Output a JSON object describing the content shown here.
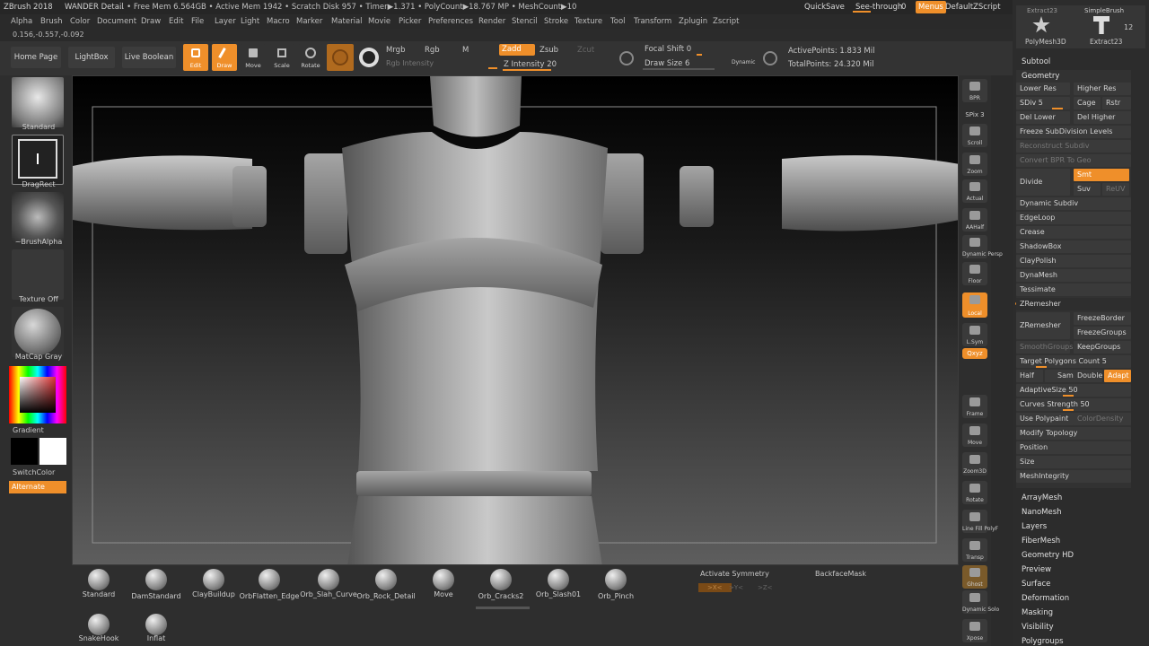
{
  "titlebar": {
    "app": "ZBrush 2018",
    "document": "WANDER Detail",
    "stats": ".. • Free Mem 6.564GB • Active Mem 1942 • Scratch Disk 957 • Timer▶1.371 • PolyCount▶18.767 MP • MeshCount▶10",
    "quicksave": "QuickSave",
    "see_through": "See-through",
    "see_through_value": "0",
    "menus": "Menus",
    "script": "DefaultZScript"
  },
  "menubar": [
    "Alpha",
    "Brush",
    "Color",
    "Document",
    "Draw",
    "Edit",
    "File",
    "Layer",
    "Light",
    "Macro",
    "Marker",
    "Material",
    "Movie",
    "Picker",
    "Preferences",
    "Render",
    "Stencil",
    "Stroke",
    "Texture",
    "Tool",
    "Transform",
    "Zplugin",
    "Zscript"
  ],
  "coords": "0.156,-0.557,-0.092",
  "shelf": {
    "home_page": "Home Page",
    "lightbox": "LightBox",
    "live_boolean": "Live Boolean",
    "edit": "Edit",
    "draw": "Draw",
    "move": "Move",
    "scale": "Scale",
    "rotate": "Rotate",
    "mrgb": "Mrgb",
    "rgb": "Rgb",
    "m": "M",
    "rgb_intensity": "Rgb Intensity",
    "zadd": "Zadd",
    "zsub": "Zsub",
    "zcut": "Zcut",
    "z_intensity": "Z Intensity 20",
    "focal_shift": "Focal Shift 0",
    "draw_size": "Draw Size 6",
    "dynamic": "Dynamic",
    "active_points": "ActivePoints: 1.833 Mil",
    "total_points": "TotalPoints: 24.320 Mil"
  },
  "left": {
    "brush": "Standard",
    "stroke": "DragRect",
    "alpha": "~BrushAlpha",
    "texture": "Texture Off",
    "material": "MatCap Gray",
    "gradient": "Gradient",
    "switch_color": "SwitchColor",
    "alternate": "Alternate"
  },
  "rightstrip": [
    "BPR",
    "SPix 3",
    "Scroll",
    "Zoom",
    "Actual",
    "AAHalf",
    "Dynamic Persp",
    "Floor",
    "Local",
    "L.Sym",
    "Qxyz",
    "",
    "",
    "Frame",
    "Move",
    "Zoom3D",
    "Rotate",
    "Line Fill PolyF",
    "Transp",
    "Ghost",
    "Dynamic Solo",
    "Xpose"
  ],
  "rightpanel": {
    "polymesh3d": "PolyMesh3D",
    "extract": "Extract23",
    "count": "12",
    "top_left": "Extract23",
    "top_right": "SimpleBrush",
    "subtool": "Subtool",
    "geometry": "Geometry",
    "lower_res": "Lower Res",
    "higher_res": "Higher Res",
    "sdiv": "SDiv 5",
    "cage": "Cage",
    "rstr": "Rstr",
    "del_lower": "Del Lower",
    "del_higher": "Del Higher",
    "freeze_sub": "Freeze SubDivision Levels",
    "reconstruct": "Reconstruct Subdiv",
    "convert_bpr": "Convert BPR To Geo",
    "divide": "Divide",
    "smt": "Smt",
    "suv": "Suv",
    "reuv": "ReUV",
    "dynamic_subdiv": "Dynamic Subdiv",
    "edgeloop": "EdgeLoop",
    "crease": "Crease",
    "shadowbox": "ShadowBox",
    "claypolish": "ClayPolish",
    "dynamesh": "DynaMesh",
    "tessimate": "Tessimate",
    "zremesher_head": "ZRemesher",
    "zremesher_btn": "ZRemesher",
    "freeze_border": "FreezeBorder",
    "freeze_groups": "FreezeGroups",
    "smooth_groups": "SmoothGroups",
    "keep_groups": "KeepGroups",
    "target_polys": "Target Polygons Count 5",
    "half": "Half",
    "same": "Same",
    "double": "Double",
    "adapt": "Adapt",
    "adaptive_size": "AdaptiveSize 50",
    "curves_strength": "Curves Strength 50",
    "use_polypaint": "Use Polypaint",
    "color_density": "ColorDensity",
    "modify_topology": "Modify Topology",
    "position": "Position",
    "size": "Size",
    "mesh_integrity": "MeshIntegrity",
    "sections": [
      "ArrayMesh",
      "NanoMesh",
      "Layers",
      "FiberMesh",
      "Geometry HD",
      "Preview",
      "Surface",
      "Deformation",
      "Masking",
      "Visibility",
      "Polygroups"
    ]
  },
  "bottom": {
    "brushes": [
      "Standard",
      "DamStandard",
      "ClayBuildup",
      "OrbFlatten_Edge",
      "Orb_Slah_Curve",
      "Orb_Rock_Detail",
      "Move",
      "Orb_Cracks2",
      "Orb_Slash01",
      "Orb_Pinch"
    ],
    "brushes2": [
      "SnakeHook",
      "Inflat"
    ],
    "activate_symmetry": "Activate Symmetry",
    "backface_mask": "BackfaceMask",
    "sym_x": ">X<",
    "sym_y": ">Y<",
    "sym_z": ">Z<"
  },
  "colors": {
    "accent": "#ef8f2a",
    "panel": "#2e2e2e",
    "button": "#3a3a3a"
  }
}
